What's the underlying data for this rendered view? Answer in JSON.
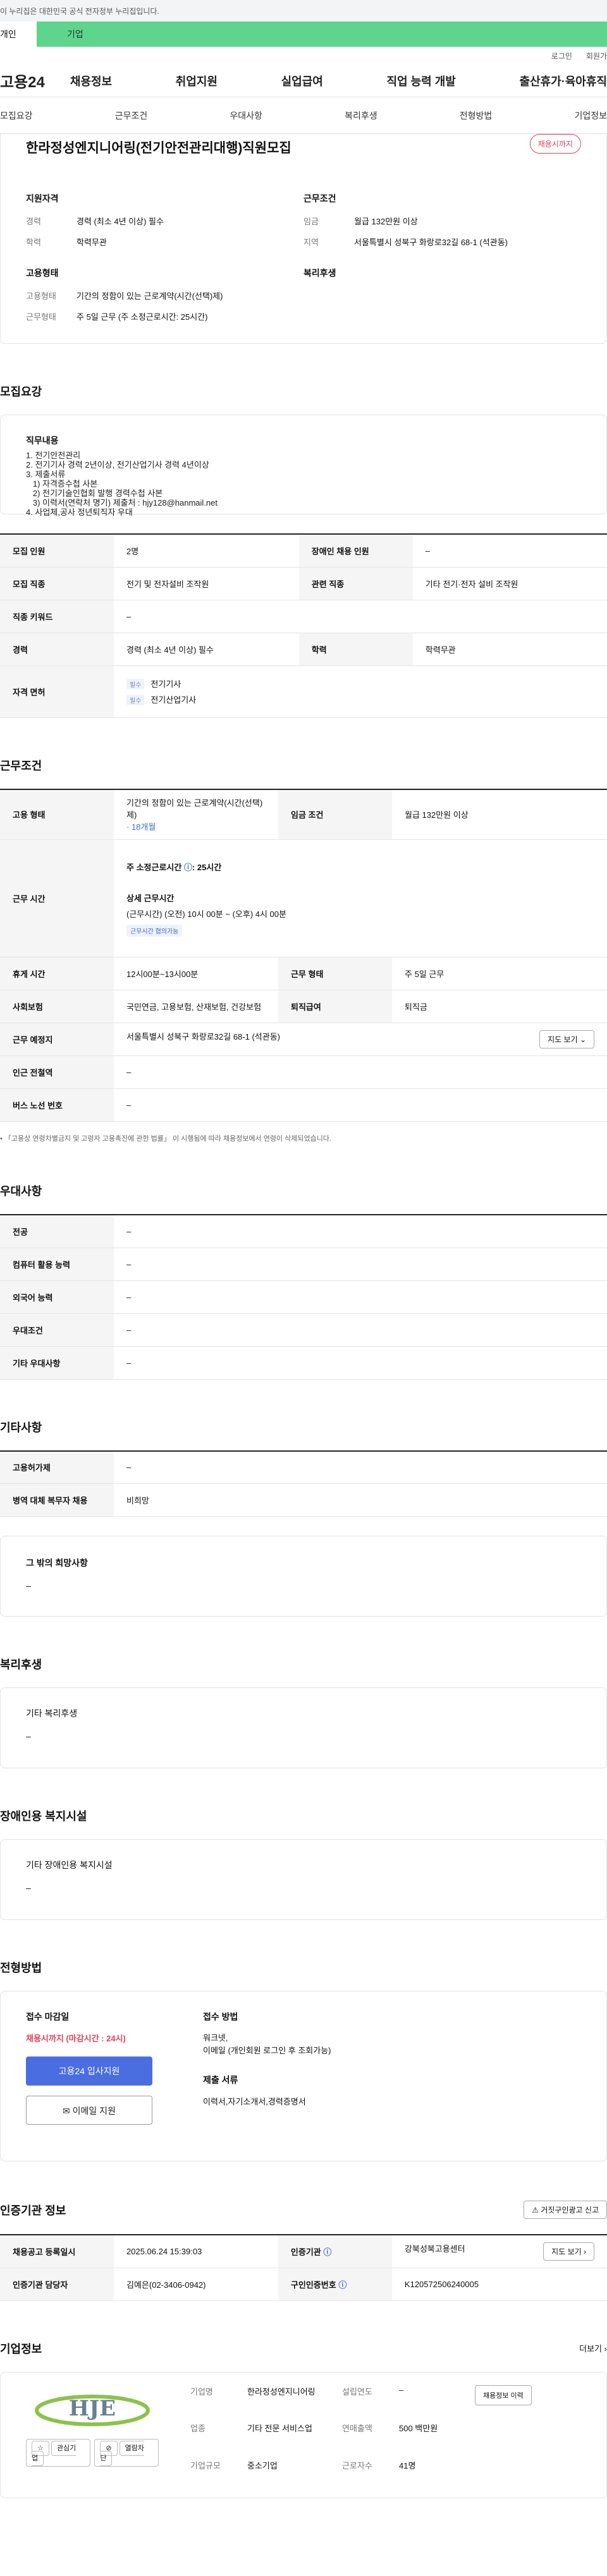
{
  "notice": "이 누리집은 대한민국 공식 전자정부 누리집입니다.",
  "audience": {
    "person": "개인",
    "company": "기업"
  },
  "util": {
    "login": "로그인",
    "join": "회원가"
  },
  "logo": "고용24",
  "gnb": [
    "채용정보",
    "취업지원",
    "실업급여",
    "직업 능력 개발",
    "출산휴가·육아휴직"
  ],
  "tabs": [
    "모집요강",
    "근무조건",
    "우대사항",
    "복리후생",
    "전형방법",
    "기업정보"
  ],
  "summary": {
    "title": "한라정성엔지니어링(전기안전관리대행)직원모집",
    "badge": "채용시까지",
    "qual_head": "지원자격",
    "work_head": "근무조건",
    "career_k": "경력",
    "career_v": "경력 (최소 4년 이상) 필수",
    "edu_k": "학력",
    "edu_v": "학력무관",
    "wage_k": "임금",
    "wage_v": "월급 132만원 이상",
    "region_k": "지역",
    "region_v": "서울특별시 성북구 화랑로32길 68-1 (석관동)",
    "emp_head": "고용형태",
    "welfare_head": "복리후생",
    "emptype_k": "고용형태",
    "emptype_v": "기간의 정함이 있는 근로계약(시간(선택)제)",
    "workform_k": "근무형태",
    "workform_v": "주 5일 근무 (주 소정근로시간: 25시간)"
  },
  "recruit": {
    "title": "모집요강",
    "duty_label": "직무내용",
    "duty_text": "1. 전기안전관리\n2. 전기기사 경력 2년이상, 전기산업기사 경력 4년이상\n3. 제출서류\n   1) 자격증수첩 사본\n   2) 전기기술인협회 발행 경력수첩 사본\n   3) 이력서(연락처 명기) 제출처 : hjy128@hanmail.net\n4. 사업체,공사 정년퇴직자 우대",
    "rows": {
      "count_k": "모집 인원",
      "count_v": "2명",
      "disabled_k": "장애인 채용 인원",
      "disabled_v": "–",
      "job_k": "모집 직종",
      "job_v": "전기 및 전자설비 조작원",
      "related_k": "관련 직종",
      "related_v": "기타 전기·전자 설비 조작원",
      "keyword_k": "직종 키워드",
      "keyword_v": "–",
      "career_k": "경력",
      "career_v": "경력 (최소 4년 이상) 필수",
      "edu_k": "학력",
      "edu_v": "학력무관",
      "license_k": "자격 면허",
      "license_tag": "필수",
      "license1": "전기기사",
      "license2": "전기산업기사"
    }
  },
  "conditions": {
    "title": "근무조건",
    "emptype_k": "고용 형태",
    "emptype_v": "기간의 정함이 있는 근로계약(시간(선택)제)",
    "emptype_period": "· 18개월",
    "wage_k": "임금 조건",
    "wage_v": "월급 132만원 이상",
    "hours_k": "근무 시간",
    "hours_main": "주 소정근로시간 ",
    "hours_value": ": 25시간",
    "hours_detail_head": "상세 근무시간",
    "hours_detail": "(근무시간) (오전) 10시 00분 ~ (오후) 4시 00분",
    "hours_badge": "근무시간 협의가능",
    "break_k": "휴게 시간",
    "break_v": "12시00분~13시00분",
    "form_k": "근무 형태",
    "form_v": "주 5일 근무",
    "insurance_k": "사회보험",
    "insurance_v": "국민연금, 고용보험, 산재보험, 건강보험",
    "severance_k": "퇴직급여",
    "severance_v": "퇴직금",
    "place_k": "근무 예정지",
    "place_v": "서울특별시 성북구 화랑로32길 68-1 (석관동)",
    "map_btn": "지도 보기",
    "subway_k": "인근 전철역",
    "subway_v": "–",
    "bus_k": "버스 노선 번호",
    "bus_v": "–",
    "note": "「고용상 연령차별금지 및 고령자 고용촉진에 관한 법률」 이 시행됨에 따라 채용정보에서 연령이 삭제되었습니다."
  },
  "preference": {
    "title": "우대사항",
    "rows": [
      {
        "k": "전공",
        "v": "–"
      },
      {
        "k": "컴퓨터 활용 능력",
        "v": "–"
      },
      {
        "k": "외국어 능력",
        "v": "–"
      },
      {
        "k": "우대조건",
        "v": "–"
      },
      {
        "k": "기타 우대사항",
        "v": "–"
      }
    ]
  },
  "etc": {
    "title": "기타사항",
    "rows": [
      {
        "k": "고용허가제",
        "v": "–"
      },
      {
        "k": "병역 대체 복무자 채용",
        "v": "비희망"
      }
    ],
    "other_label": "그 밖의 희망사항",
    "other_v": "–"
  },
  "welfare": {
    "title": "복리후생",
    "label": "기타 복리후생",
    "v": "–"
  },
  "disability": {
    "title": "장애인용 복지시설",
    "label": "기타 장애인용 복지시설",
    "v": "–"
  },
  "process": {
    "title": "전형방법",
    "deadline_head": "접수 마감일",
    "deadline": "채용시까지 (마감시간 : 24시)",
    "apply_btn": "고용24 입사지원",
    "email_btn": "이메일 지원",
    "method_head": "접수 방법",
    "method_v": "워크넷,\n이메일 (개인회원 로그인 후 조회가능)",
    "docs_head": "제출 서류",
    "docs_v": "이력서,자기소개서,경력증명서"
  },
  "institution": {
    "title": "인증기관 정보",
    "report_btn": "거짓구인광고 신고",
    "date_k": "채용공고 등록일시",
    "date_v": "2025.06.24 15:39:03",
    "org_k": "인증기관",
    "org_v": "강북성북고용센터",
    "map_btn": "지도 보기",
    "manager_k": "인증기관 담당자",
    "manager_v": "김예은(02-3406-0942)",
    "num_k": "구인인증번호",
    "num_v": "K120572506240005"
  },
  "company": {
    "title": "기업정보",
    "more": "더보기",
    "fav_btn": "관심기업",
    "block_btn": "열람차단",
    "name_k": "기업명",
    "name_v": "한라정성엔지니어링",
    "estab_k": "설립연도",
    "estab_v": "–",
    "industry_k": "업종",
    "industry_v": "기타 전문 서비스업",
    "sales_k": "연매출액",
    "sales_v": "500 백만원",
    "size_k": "기업규모",
    "size_v": "중소기업",
    "emp_k": "근로자수",
    "emp_v": "41명",
    "job_btn": "채용정보 이력"
  }
}
